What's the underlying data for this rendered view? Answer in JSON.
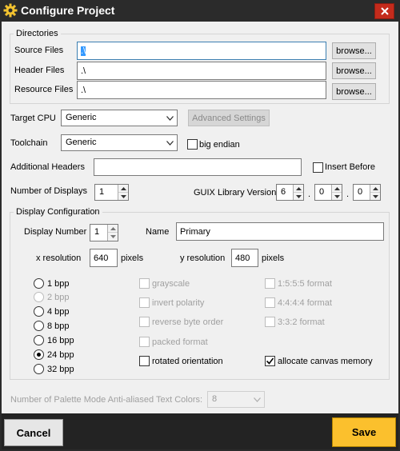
{
  "window": {
    "title": "Configure Project",
    "icon": "gear-icon",
    "close_icon": "close-icon"
  },
  "directories": {
    "legend": "Directories",
    "source_label": "Source Files",
    "source_value": ".\\",
    "header_label": "Header Files",
    "header_value": ".\\",
    "resource_label": "Resource Files",
    "resource_value": ".\\",
    "browse_label": "browse..."
  },
  "target_cpu": {
    "label": "Target CPU",
    "value": "Generic",
    "advanced_label": "Advanced Settings"
  },
  "toolchain": {
    "label": "Toolchain",
    "value": "Generic",
    "big_endian_label": "big endian",
    "big_endian_checked": false
  },
  "additional_headers": {
    "label": "Additional Headers",
    "value": "",
    "insert_before_label": "Insert Before",
    "insert_before_checked": false
  },
  "displays": {
    "label": "Number of Displays",
    "value": "1",
    "guix_label": "GUIX Library Version",
    "guix_major": "6",
    "guix_minor": "0",
    "guix_patch": "0",
    "dot": "."
  },
  "display_config": {
    "legend": "Display Configuration",
    "number_label": "Display Number",
    "number_value": "1",
    "name_label": "Name",
    "name_value": "Primary",
    "xres_label": "x resolution",
    "xres_value": "640",
    "yres_label": "y resolution",
    "yres_value": "480",
    "pixels_label": "pixels",
    "bpp_options": [
      {
        "label": "1 bpp",
        "selected": false,
        "enabled": true
      },
      {
        "label": "2 bpp",
        "selected": false,
        "enabled": false
      },
      {
        "label": "4 bpp",
        "selected": false,
        "enabled": true
      },
      {
        "label": "8 bpp",
        "selected": false,
        "enabled": true
      },
      {
        "label": "16 bpp",
        "selected": false,
        "enabled": true
      },
      {
        "label": "24 bpp",
        "selected": true,
        "enabled": true
      },
      {
        "label": "32 bpp",
        "selected": false,
        "enabled": true
      }
    ],
    "options": [
      {
        "label": "grayscale",
        "checked": false,
        "enabled": false
      },
      {
        "label": "invert polarity",
        "checked": false,
        "enabled": false
      },
      {
        "label": "reverse byte order",
        "checked": false,
        "enabled": false
      },
      {
        "label": "packed format",
        "checked": false,
        "enabled": false
      },
      {
        "label": "rotated orientation",
        "checked": false,
        "enabled": true
      }
    ],
    "formats": [
      {
        "label": "1:5:5:5 format",
        "checked": false,
        "enabled": false
      },
      {
        "label": "4:4:4:4 format",
        "checked": false,
        "enabled": false
      },
      {
        "label": "3:3:2 format",
        "checked": false,
        "enabled": false
      },
      {
        "label": "allocate canvas memory",
        "checked": true,
        "enabled": true
      }
    ]
  },
  "palette": {
    "label": "Number of Palette Mode Anti-aliased Text Colors:",
    "value": "8",
    "enabled": false
  },
  "buttons": {
    "cancel": "Cancel",
    "save": "Save"
  },
  "colors": {
    "title_bar": "#2b2b2b",
    "close": "#c42b1c",
    "save": "#fbc02d",
    "selection": "#3399ff"
  }
}
